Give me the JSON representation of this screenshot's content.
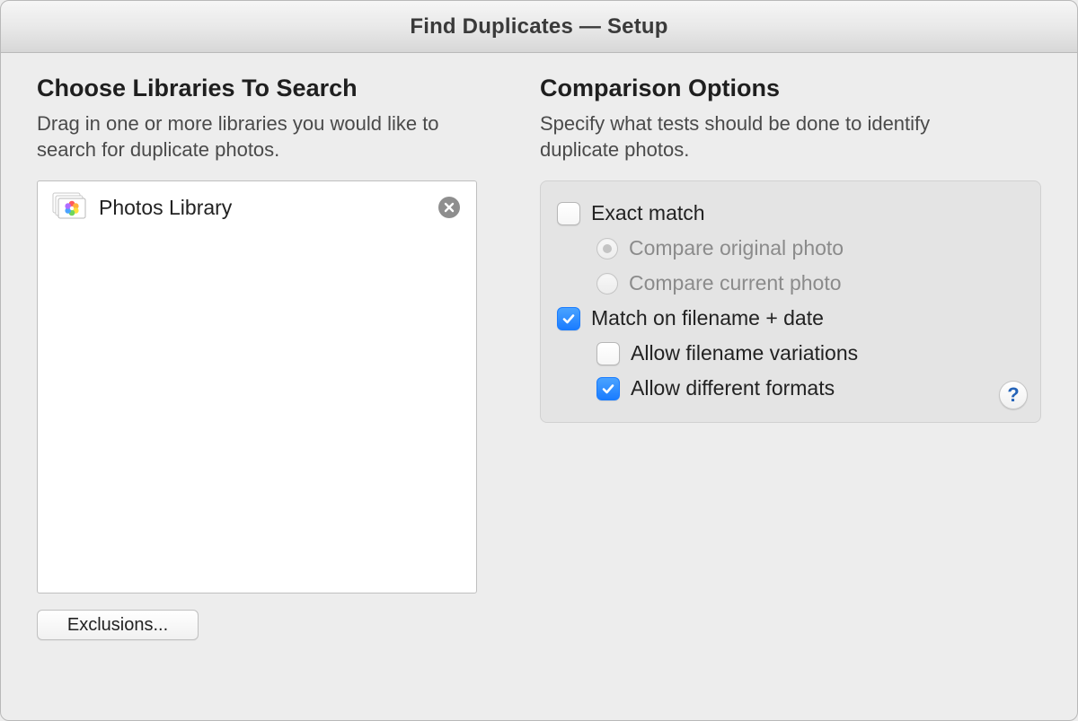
{
  "window": {
    "title": "Find Duplicates — Setup"
  },
  "left": {
    "heading": "Choose Libraries To Search",
    "subtitle": "Drag in one or more libraries you would like to search for duplicate photos.",
    "libraries": [
      {
        "name": "Photos Library"
      }
    ],
    "exclusions_button": "Exclusions..."
  },
  "right": {
    "heading": "Comparison Options",
    "subtitle": "Specify what tests should be done to identify duplicate photos.",
    "options": {
      "exact_match": {
        "label": "Exact match",
        "checked": false
      },
      "compare_original": {
        "label": "Compare original photo",
        "selected": true,
        "enabled": false
      },
      "compare_current": {
        "label": "Compare current photo",
        "selected": false,
        "enabled": false
      },
      "match_filename_date": {
        "label": "Match on filename + date",
        "checked": true
      },
      "allow_filename_variations": {
        "label": "Allow filename variations",
        "checked": false
      },
      "allow_different_formats": {
        "label": "Allow different formats",
        "checked": true
      }
    },
    "help_label": "?"
  }
}
